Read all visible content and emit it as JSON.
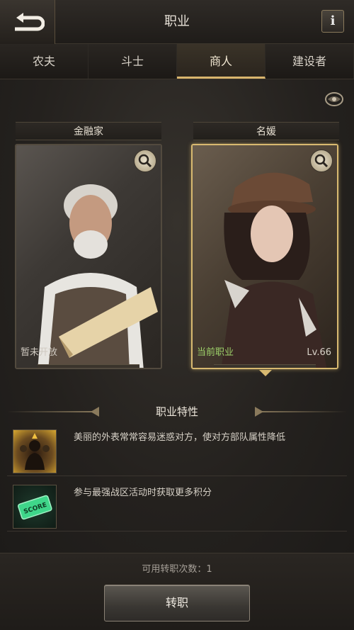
{
  "header": {
    "title": "职业",
    "info_label": "i"
  },
  "tabs": [
    {
      "label": "农夫",
      "active": false
    },
    {
      "label": "斗士",
      "active": false
    },
    {
      "label": "商人",
      "active": true
    },
    {
      "label": "建设者",
      "active": false
    }
  ],
  "cards": [
    {
      "name": "金融家",
      "status": "暂未开放",
      "status_color": "#cfc9c0",
      "level": "",
      "selected": false
    },
    {
      "name": "名媛",
      "status": "当前职业",
      "status_color": "#9fd36a",
      "level": "Lv.66",
      "selected": true
    }
  ],
  "traits": {
    "title": "职业特性",
    "items": [
      {
        "icon": "troop-debuff-icon",
        "text": "美丽的外表常常容易迷惑对方，使对方部队属性降低"
      },
      {
        "icon": "score-ticket-icon",
        "text": "参与最强战区活动时获取更多积分"
      }
    ]
  },
  "footer": {
    "transfer_count_label": "可用转职次数：1",
    "transfer_button": "转职"
  },
  "colors": {
    "accent_gold": "#d8b970",
    "active_status": "#9fd36a"
  }
}
